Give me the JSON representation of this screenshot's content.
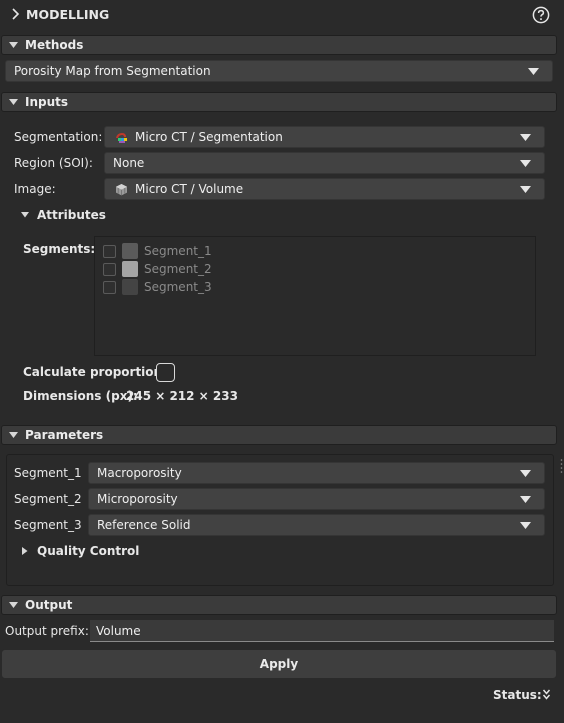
{
  "header": {
    "title": "MODELLING",
    "chevron_icon": "chevron-right-icon",
    "help_icon": "question-circle-icon"
  },
  "methods": {
    "title": "Methods",
    "method": "Porosity Map from Segmentation"
  },
  "inputs": {
    "title": "Inputs",
    "segmentation": {
      "label": "Segmentation:",
      "value": "Micro CT / Segmentation",
      "icon": "segmentation-icon"
    },
    "region": {
      "label": "Region (SOI):",
      "value": "None"
    },
    "image": {
      "label": "Image:",
      "value": "Micro CT / Volume",
      "icon": "volume-icon"
    },
    "attributes": {
      "title": "Attributes",
      "segments_label": "Segments:",
      "segments": [
        {
          "name": "Segment_1",
          "color": "#5b5b5b",
          "checked": false
        },
        {
          "name": "Segment_2",
          "color": "#a4a4a4",
          "checked": false
        },
        {
          "name": "Segment_3",
          "color": "#444444",
          "checked": false
        }
      ]
    },
    "calculate_proportions": {
      "label": "Calculate proportions:",
      "checked": false
    },
    "dimensions": {
      "label": "Dimensions (px):",
      "value": "245 × 212 × 233"
    }
  },
  "parameters": {
    "title": "Parameters",
    "rows": [
      {
        "label": "Segment_1",
        "value": "Macroporosity"
      },
      {
        "label": "Segment_2",
        "value": "Microporosity"
      },
      {
        "label": "Segment_3",
        "value": "Reference Solid"
      }
    ],
    "quality_control": "Quality Control"
  },
  "output": {
    "title": "Output",
    "prefix_label": "Output prefix:",
    "prefix_value": "Volume"
  },
  "apply_label": "Apply",
  "status": {
    "label": "Status:",
    "icon": "double-chevron-down-icon"
  },
  "colors": {
    "background": "#2a2a2a",
    "section_bar": "#3b3b3b",
    "combo": "#424242",
    "text": "#e8e8e8",
    "disabled_text": "#8a8a8a"
  }
}
